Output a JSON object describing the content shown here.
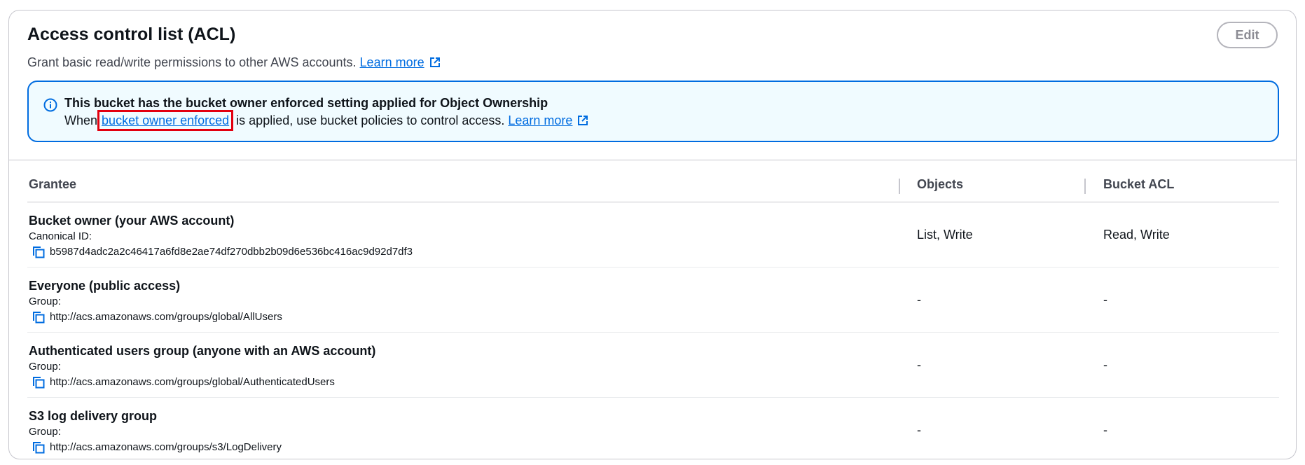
{
  "header": {
    "title": "Access control list (ACL)",
    "description": "Grant basic read/write permissions to other AWS accounts.",
    "learn_more": "Learn more",
    "edit_label": "Edit"
  },
  "alert": {
    "title": "This bucket has the bucket owner enforced setting applied for Object Ownership",
    "body_prefix": "When",
    "body_link": "bucket owner enforced",
    "body_suffix": "is applied, use bucket policies to control access.",
    "learn_more": "Learn more"
  },
  "table": {
    "columns": [
      "Grantee",
      "Objects",
      "Bucket ACL"
    ],
    "rows": [
      {
        "name": "Bucket owner (your AWS account)",
        "label": "Canonical ID:",
        "id": "b5987d4adc2a2c46417a6fd8e2ae74df270dbb2b09d6e536bc416ac9d92d7df3",
        "objects": "List, Write",
        "bucket_acl": "Read, Write"
      },
      {
        "name": "Everyone (public access)",
        "label": "Group:",
        "id": "http://acs.amazonaws.com/groups/global/AllUsers",
        "objects": "-",
        "bucket_acl": "-"
      },
      {
        "name": "Authenticated users group (anyone with an AWS account)",
        "label": "Group:",
        "id": "http://acs.amazonaws.com/groups/global/AuthenticatedUsers",
        "objects": "-",
        "bucket_acl": "-"
      },
      {
        "name": "S3 log delivery group",
        "label": "Group:",
        "id": "http://acs.amazonaws.com/groups/s3/LogDelivery",
        "objects": "-",
        "bucket_acl": "-"
      }
    ]
  },
  "icons": {
    "info": "info-icon",
    "external": "external-link-icon",
    "copy": "copy-icon"
  },
  "colors": {
    "link": "#006ce0",
    "alert_border": "#006ce0",
    "alert_bg": "#f0fbff",
    "highlight": "#e3000f"
  }
}
